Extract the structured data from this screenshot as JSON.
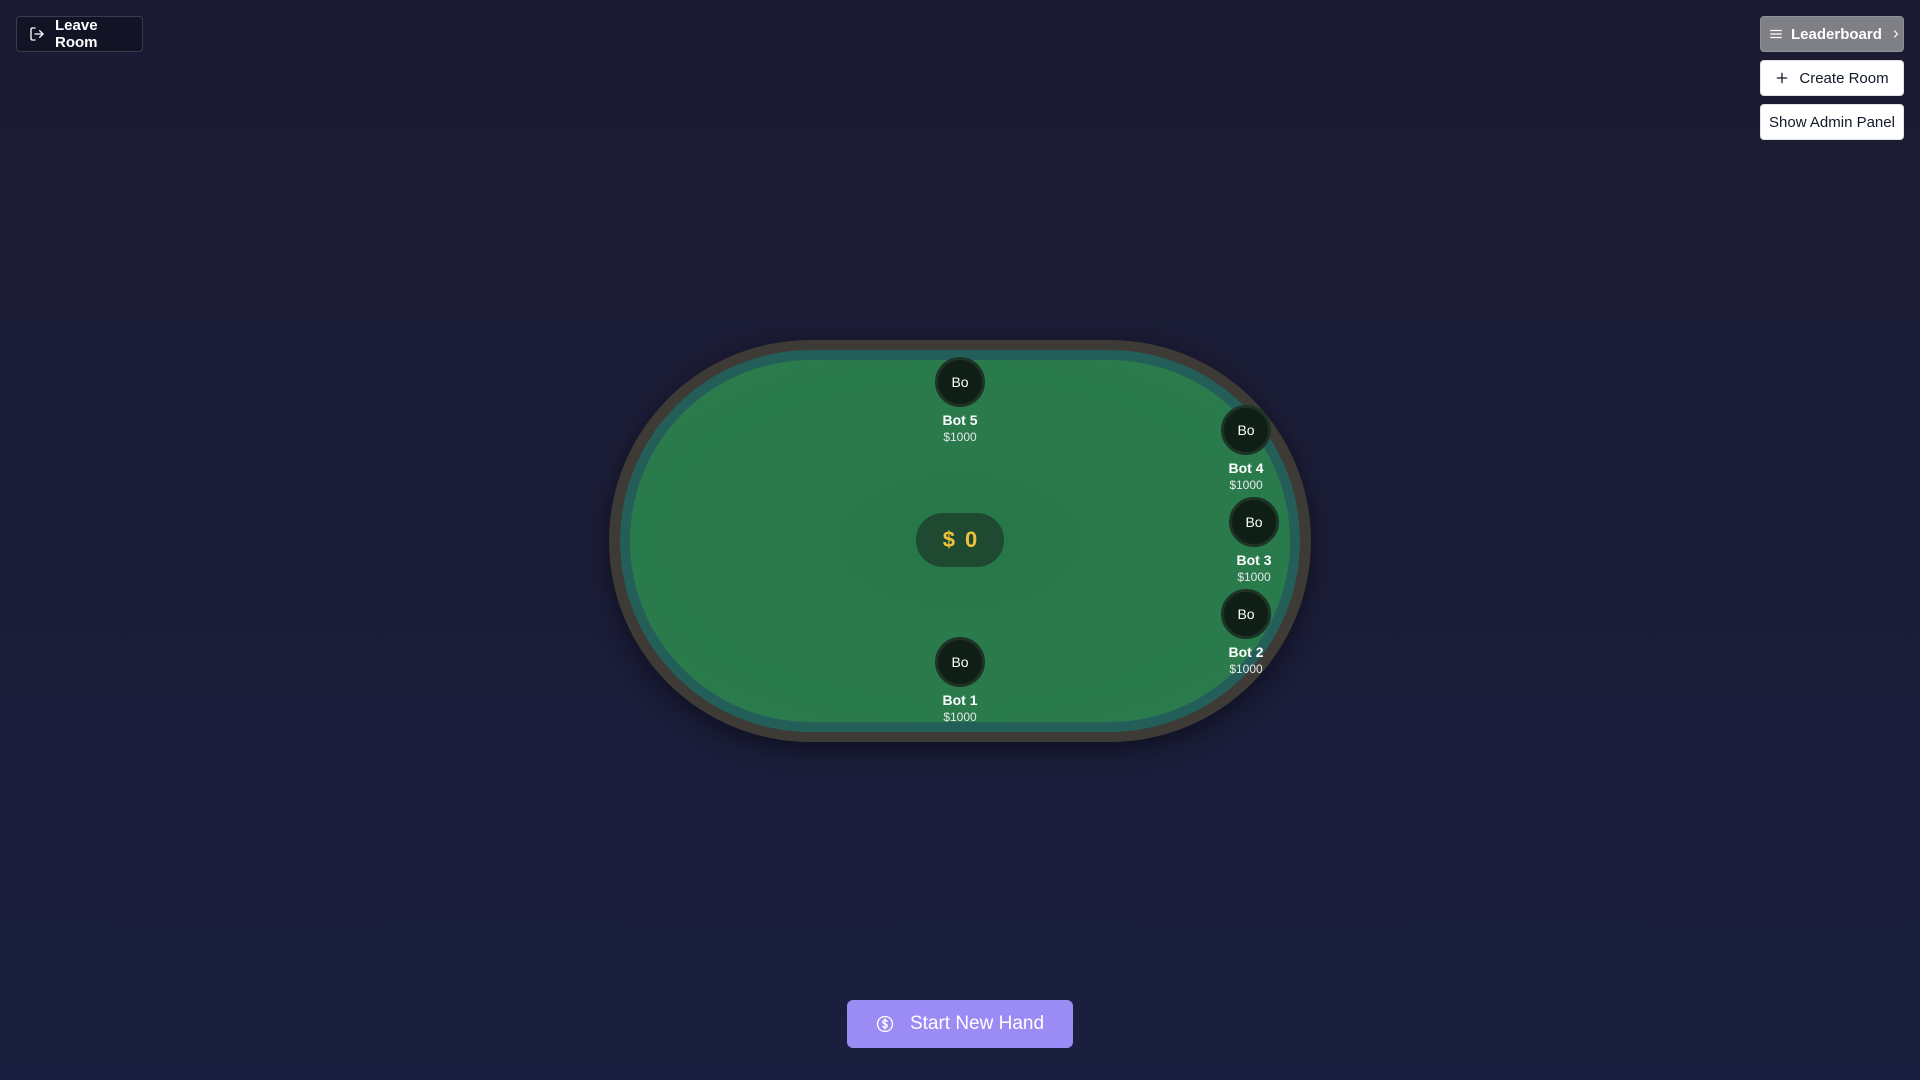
{
  "header": {
    "leave_room_label": "Leave Room",
    "leaderboard_label": "Leaderboard",
    "create_room_label": "Create Room",
    "admin_panel_label": "Show Admin Panel"
  },
  "table": {
    "pot_symbol": "$",
    "pot_amount": "0",
    "players": [
      {
        "initials": "Bo",
        "name": "Bot 5",
        "chips": "$1000"
      },
      {
        "initials": "Bo",
        "name": "Bot 4",
        "chips": "$1000"
      },
      {
        "initials": "Bo",
        "name": "Bot 3",
        "chips": "$1000"
      },
      {
        "initials": "Bo",
        "name": "Bot 2",
        "chips": "$1000"
      },
      {
        "initials": "Bo",
        "name": "Bot 1",
        "chips": "$1000"
      }
    ]
  },
  "actions": {
    "start_new_hand_label": "Start New Hand"
  },
  "colors": {
    "background": "#1b1d38",
    "felt": "#2b7c4d",
    "rail": "#3e3a36",
    "pot_text": "#f0c23a",
    "start_button": "#9a8bf5"
  },
  "icons": [
    "log-out-icon",
    "menu-icon",
    "chevron-right-icon",
    "plus-icon",
    "dollar-circle-icon"
  ]
}
